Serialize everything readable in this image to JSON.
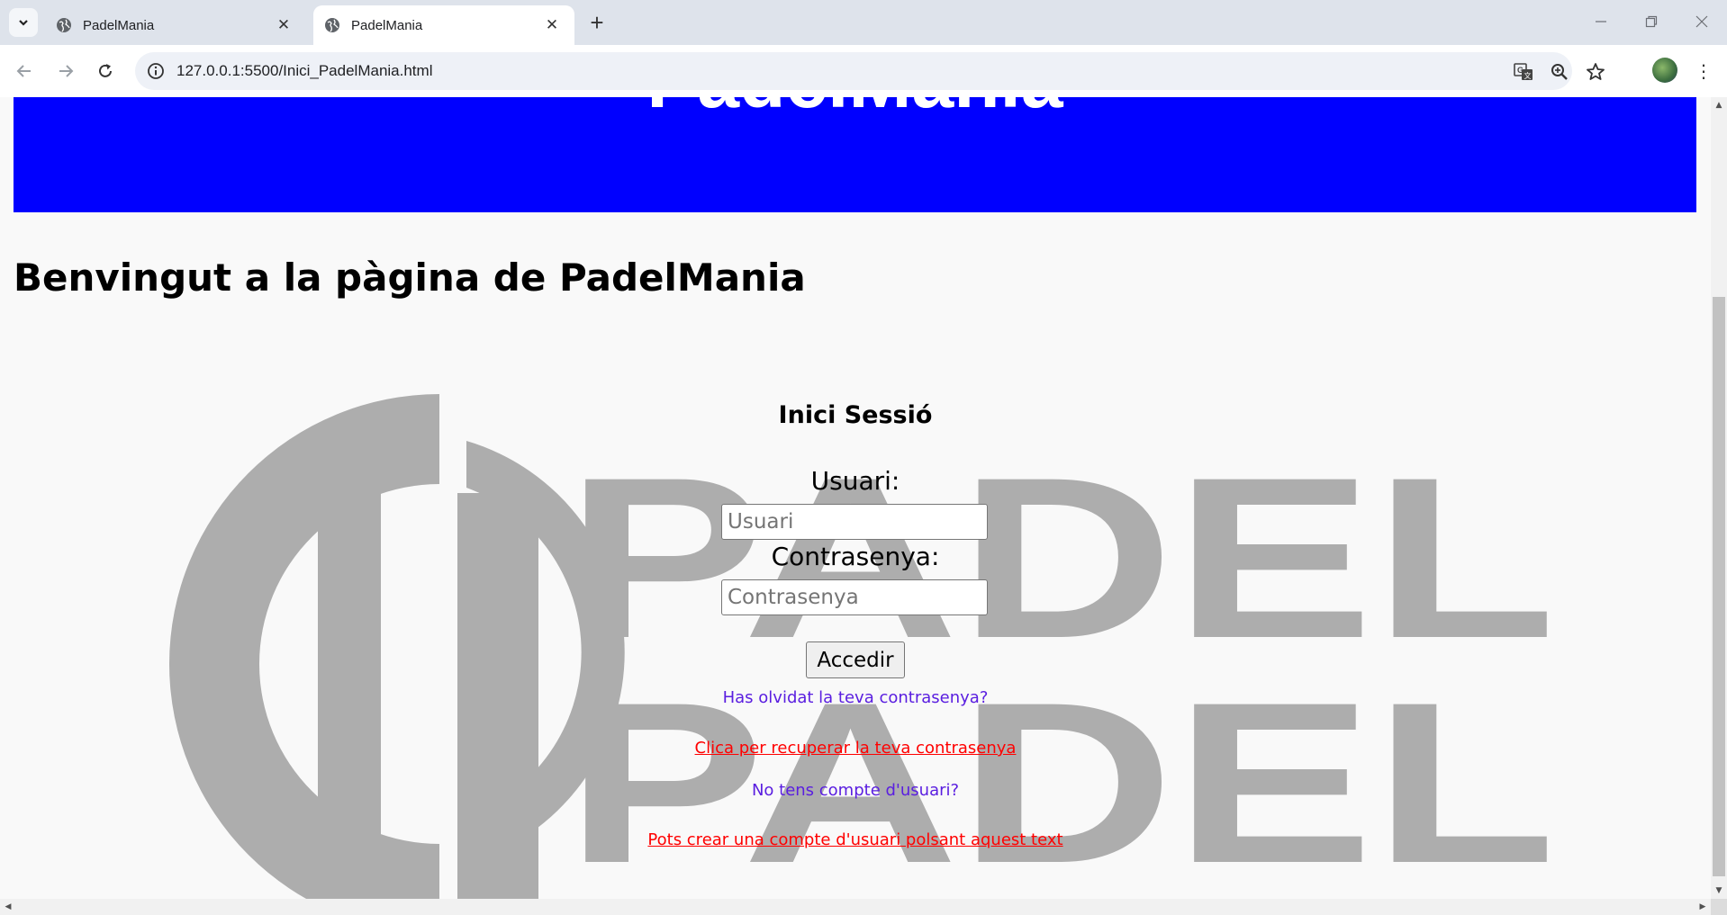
{
  "browser": {
    "tabs": [
      {
        "title": "PadelMania",
        "active": false
      },
      {
        "title": "PadelMania",
        "active": true
      }
    ],
    "url": "127.0.0.1:5500/Inici_PadelMania.html",
    "icons": [
      "tab-search-icon",
      "globe-icon",
      "close-icon",
      "plus-icon",
      "minimize-icon",
      "restore-icon",
      "back-icon",
      "forward-icon",
      "reload-icon",
      "info-icon",
      "translate-icon",
      "zoom-icon",
      "star-icon",
      "profile-avatar",
      "more-icon"
    ],
    "colors": {
      "tabbar": "#dee3eb",
      "omnibox": "#eef1f7"
    }
  },
  "page": {
    "header_title": "PadelMania",
    "header_color": "#0000ff",
    "welcome": "Benvingut a la pàgina de PadelMania",
    "watermark": {
      "text_line1": "PADEL",
      "text_line2": "PADEL",
      "color": "#adadad"
    },
    "login": {
      "title": "Inici Sessió",
      "user_label": "Usuari:",
      "user_placeholder": "Usuari",
      "user_value": "",
      "password_label": "Contrasenya:",
      "password_placeholder": "Contrasenya",
      "password_value": "",
      "submit": "Accedir",
      "forgot_text": "Has olvidat la teva contrasenya?",
      "recover_link": "Clica per recuperar la teva contrasenya",
      "no_account_text": "No tens compte d'usuari?",
      "create_link": "Pots crear una compte d'usuari polsant aquest text"
    }
  }
}
